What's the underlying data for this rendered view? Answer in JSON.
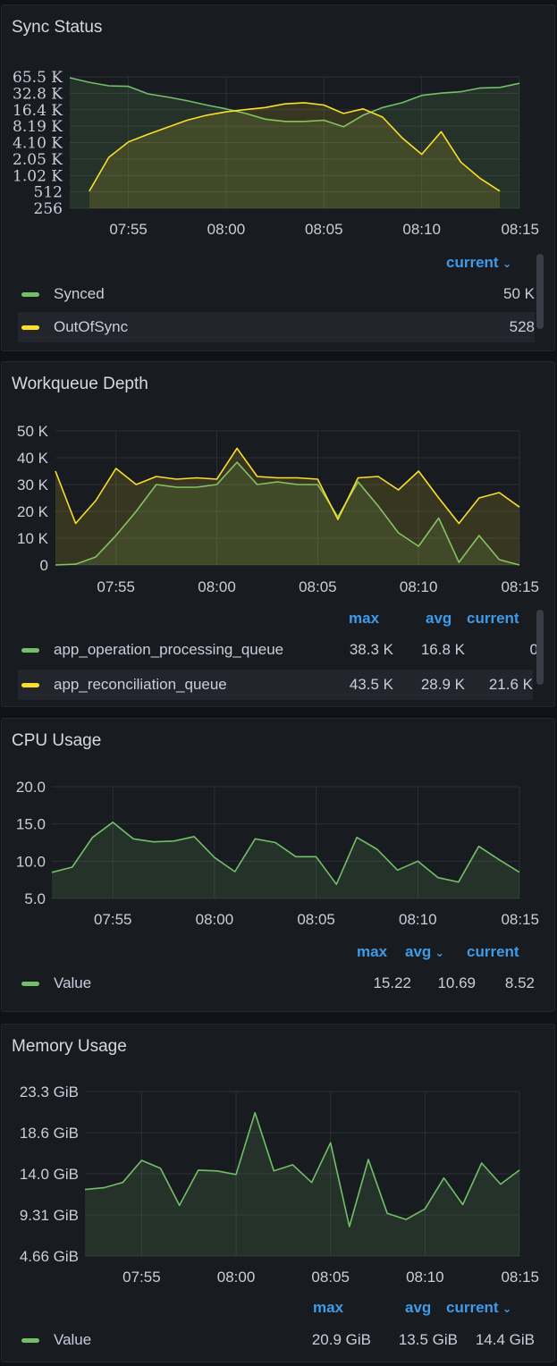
{
  "colors": {
    "green": "#73bf69",
    "yellow": "#fade2a",
    "link": "#3d9be9"
  },
  "x_ticks": [
    "07:55",
    "08:00",
    "08:05",
    "08:10",
    "08:15"
  ],
  "panels": [
    {
      "title": "Sync Status",
      "y_ticks": [
        "65.5 K",
        "32.8 K",
        "16.4 K",
        "8.19 K",
        "4.10 K",
        "2.05 K",
        "1.02 K",
        "512",
        "256"
      ],
      "legend": {
        "headers": [
          "current"
        ],
        "header_menu_icon": "chevron-down-icon",
        "rows": [
          {
            "name": "Synced",
            "color": "#73bf69",
            "values": [
              "50 K"
            ]
          },
          {
            "name": "OutOfSync",
            "color": "#fade2a",
            "values": [
              "528"
            ]
          }
        ]
      }
    },
    {
      "title": "Workqueue Depth",
      "y_ticks": [
        "50 K",
        "40 K",
        "30 K",
        "20 K",
        "10 K",
        "0"
      ],
      "legend": {
        "headers": [
          "max",
          "avg",
          "current"
        ],
        "rows": [
          {
            "name": "app_operation_processing_queue",
            "color": "#73bf69",
            "values": [
              "38.3 K",
              "16.8 K",
              "0"
            ]
          },
          {
            "name": "app_reconciliation_queue",
            "color": "#fade2a",
            "values": [
              "43.5 K",
              "28.9 K",
              "21.6 K"
            ]
          }
        ]
      }
    },
    {
      "title": "CPU Usage",
      "y_ticks": [
        "20.0",
        "15.0",
        "10.0",
        "5.0"
      ],
      "legend": {
        "headers": [
          "max",
          "avg",
          "current"
        ],
        "header_menu_icon": "chevron-down-icon",
        "rows": [
          {
            "name": "Value",
            "color": "#73bf69",
            "values": [
              "15.22",
              "10.69",
              "8.52"
            ]
          }
        ]
      }
    },
    {
      "title": "Memory Usage",
      "y_ticks": [
        "23.3 GiB",
        "18.6 GiB",
        "14.0 GiB",
        "9.31 GiB",
        "4.66 GiB"
      ],
      "legend": {
        "headers": [
          "max",
          "avg",
          "current"
        ],
        "header_menu_icon": "chevron-down-icon",
        "rows": [
          {
            "name": "Value",
            "color": "#73bf69",
            "values": [
              "20.9 GiB",
              "13.5 GiB",
              "14.4 GiB"
            ]
          }
        ]
      }
    }
  ],
  "chart_data": [
    {
      "type": "area",
      "title": "Sync Status",
      "log_scale": true,
      "x_range": [
        "07:52",
        "08:15"
      ],
      "ylim": [
        256,
        65536
      ],
      "series": [
        {
          "name": "Synced",
          "x": [
            "07:52",
            "07:53",
            "07:54",
            "07:55",
            "07:56",
            "07:57",
            "07:58",
            "07:59",
            "08:00",
            "08:01",
            "08:02",
            "08:03",
            "08:04",
            "08:05",
            "08:06",
            "08:07",
            "08:08",
            "08:09",
            "08:10",
            "08:11",
            "08:12",
            "08:13",
            "08:14",
            "08:15"
          ],
          "values": [
            63000,
            52000,
            45000,
            44000,
            32000,
            28000,
            24000,
            20000,
            17000,
            14000,
            11000,
            10000,
            10000,
            10500,
            8000,
            13000,
            18000,
            22000,
            30000,
            33000,
            35000,
            41000,
            42000,
            50000
          ]
        },
        {
          "name": "OutOfSync",
          "x": [
            "07:53",
            "07:54",
            "07:55",
            "07:56",
            "07:57",
            "07:58",
            "07:59",
            "08:00",
            "08:01",
            "08:02",
            "08:03",
            "08:04",
            "08:05",
            "08:06",
            "08:07",
            "08:08",
            "08:09",
            "08:10",
            "08:11",
            "08:12",
            "08:13",
            "08:14"
          ],
          "values": [
            528,
            2200,
            4200,
            5800,
            7800,
            10500,
            13000,
            15000,
            16500,
            18000,
            21000,
            22000,
            20000,
            14000,
            17000,
            12000,
            5000,
            2500,
            6500,
            1800,
            900,
            528
          ]
        }
      ]
    },
    {
      "type": "area",
      "title": "Workqueue Depth",
      "x_range": [
        "07:52",
        "08:15"
      ],
      "ylim": [
        0,
        50000
      ],
      "series": [
        {
          "name": "app_operation_processing_queue",
          "x": [
            "07:52",
            "07:53",
            "07:54",
            "07:55",
            "07:56",
            "07:57",
            "07:58",
            "07:59",
            "08:00",
            "08:01",
            "08:02",
            "08:03",
            "08:04",
            "08:05",
            "08:06",
            "08:07",
            "08:08",
            "08:09",
            "08:10",
            "08:11",
            "08:12",
            "08:13",
            "08:14",
            "08:15"
          ],
          "values": [
            0,
            300,
            3000,
            11000,
            20000,
            30000,
            29000,
            29000,
            30000,
            38300,
            30000,
            31000,
            30000,
            30000,
            18000,
            31000,
            22000,
            12000,
            7000,
            17500,
            1000,
            11000,
            2000,
            0
          ]
        },
        {
          "name": "app_reconciliation_queue",
          "x": [
            "07:52",
            "07:53",
            "07:54",
            "07:55",
            "07:56",
            "07:57",
            "07:58",
            "07:59",
            "08:00",
            "08:01",
            "08:02",
            "08:03",
            "08:04",
            "08:05",
            "08:06",
            "08:07",
            "08:08",
            "08:09",
            "08:10",
            "08:11",
            "08:12",
            "08:13",
            "08:14",
            "08:15"
          ],
          "values": [
            35000,
            15500,
            24000,
            36000,
            30000,
            33000,
            32000,
            32500,
            32000,
            43500,
            33000,
            32500,
            32500,
            32000,
            17000,
            32500,
            33000,
            28000,
            35000,
            25000,
            15500,
            25000,
            27000,
            21600
          ]
        }
      ]
    },
    {
      "type": "area",
      "title": "CPU Usage",
      "x_range": [
        "07:52",
        "08:15"
      ],
      "ylim": [
        5,
        20
      ],
      "series": [
        {
          "name": "Value",
          "x": [
            "07:52",
            "07:53",
            "07:54",
            "07:55",
            "07:56",
            "07:57",
            "07:58",
            "07:59",
            "08:00",
            "08:01",
            "08:02",
            "08:03",
            "08:04",
            "08:05",
            "08:06",
            "08:07",
            "08:08",
            "08:09",
            "08:10",
            "08:11",
            "08:12",
            "08:13",
            "08:14",
            "08:15"
          ],
          "values": [
            8.5,
            9.2,
            13.2,
            15.22,
            13,
            12.6,
            12.7,
            13.3,
            10.5,
            8.6,
            13.0,
            12.5,
            10.6,
            10.6,
            6.9,
            13.2,
            11.6,
            8.8,
            10.0,
            7.8,
            7.2,
            12.0,
            10.2,
            8.52
          ]
        }
      ]
    },
    {
      "type": "area",
      "title": "Memory Usage",
      "x_range": [
        "07:52",
        "08:15"
      ],
      "ylim": [
        4.66,
        23.3
      ],
      "series": [
        {
          "name": "Value",
          "x": [
            "07:52",
            "07:53",
            "07:54",
            "07:55",
            "07:56",
            "07:57",
            "07:58",
            "07:59",
            "08:00",
            "08:01",
            "08:02",
            "08:03",
            "08:04",
            "08:05",
            "08:06",
            "08:07",
            "08:08",
            "08:09",
            "08:10",
            "08:11",
            "08:12",
            "08:13",
            "08:14",
            "08:15"
          ],
          "values": [
            12.2,
            12.4,
            13.0,
            15.5,
            14.6,
            10.4,
            14.4,
            14.3,
            13.9,
            20.9,
            14.3,
            15.0,
            13.0,
            17.5,
            8.0,
            15.6,
            9.5,
            8.8,
            10.0,
            13.5,
            10.5,
            15.2,
            12.8,
            14.4
          ]
        }
      ]
    }
  ]
}
